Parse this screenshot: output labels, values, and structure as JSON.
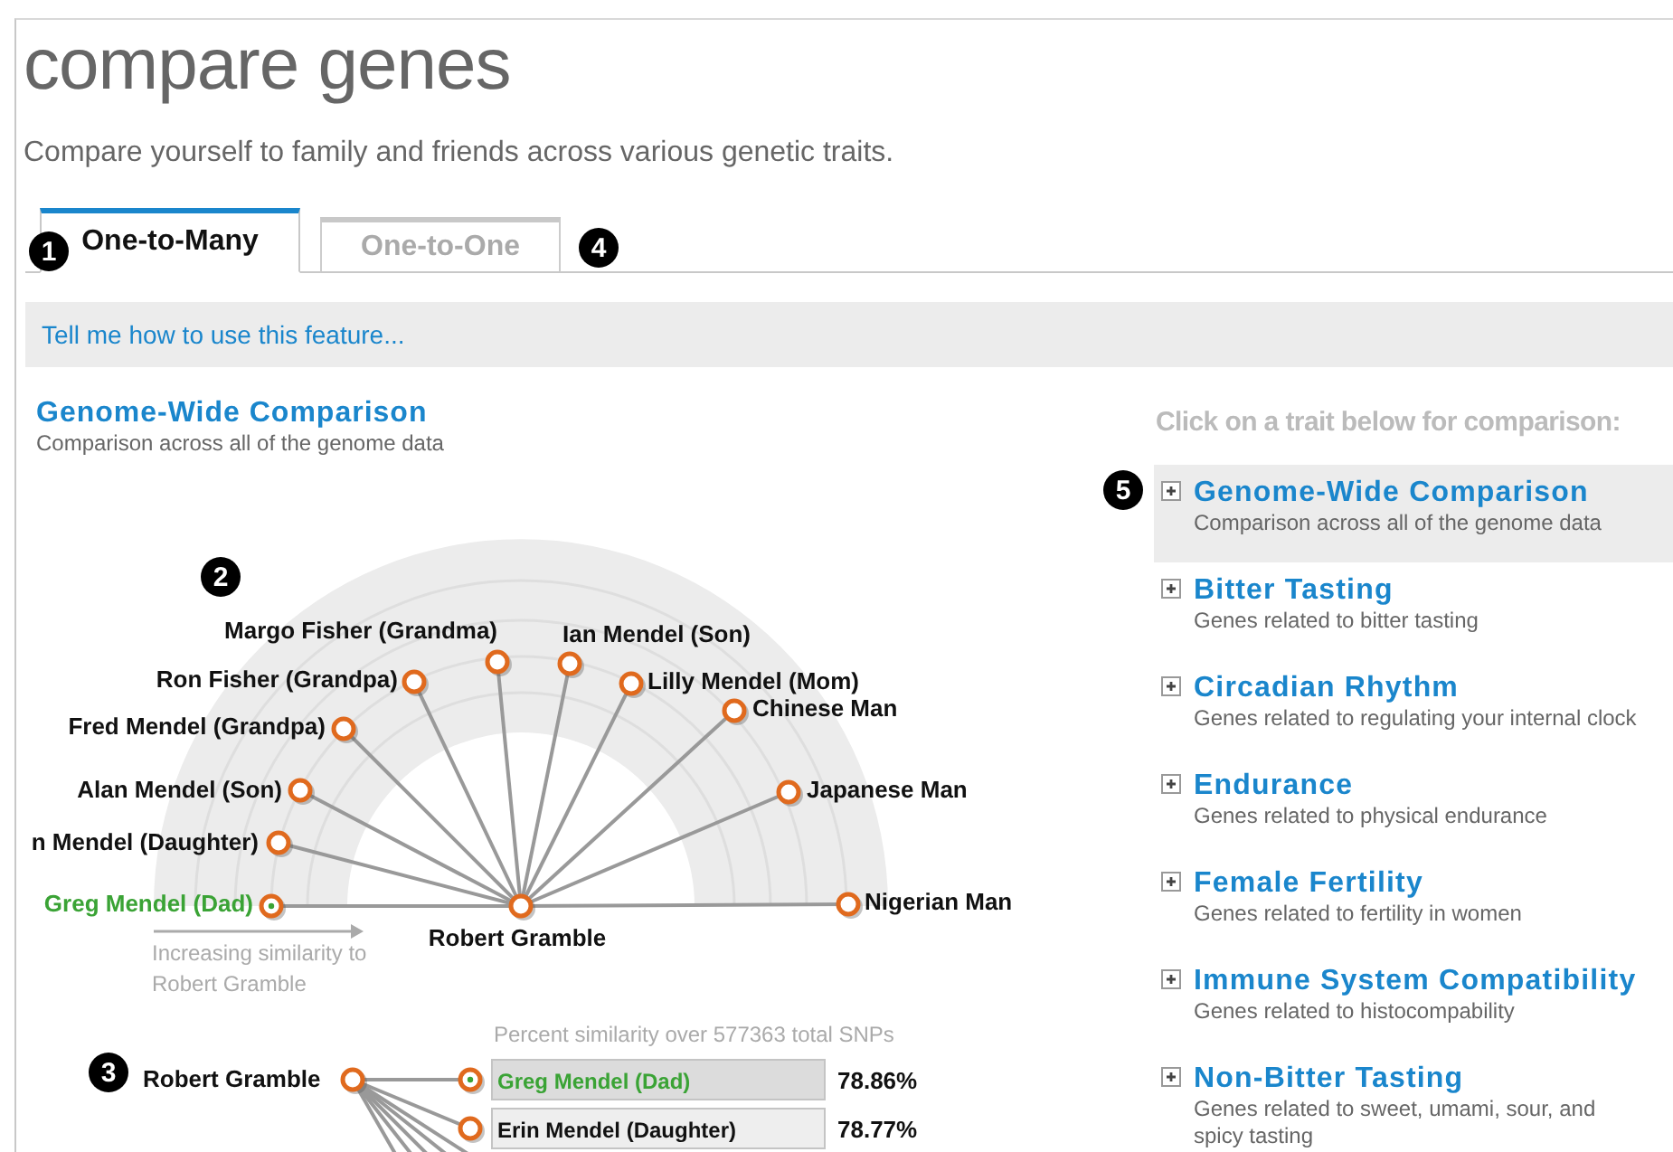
{
  "page": {
    "title": "compare genes",
    "subtitle": "Compare yourself to family and friends across various genetic traits."
  },
  "tabs": [
    {
      "label": "One-to-Many",
      "selected": true
    },
    {
      "label": "One-to-One",
      "selected": false
    }
  ],
  "help_link": "Tell me how to use this feature...",
  "section": {
    "title": "Genome-Wide Comparison",
    "description": "Comparison across all of the genome data"
  },
  "radial_chart": {
    "center": "Robert Gramble",
    "axis_note": "Increasing similarity to Robert Gramble",
    "nodes": [
      {
        "name": "Margo Fisher (Grandma)",
        "highlighted": false
      },
      {
        "name": "Ian Mendel (Son)",
        "highlighted": false
      },
      {
        "name": "Ron Fisher (Grandpa)",
        "highlighted": false
      },
      {
        "name": "Lilly Mendel (Mom)",
        "highlighted": false
      },
      {
        "name": "Fred Mendel (Grandpa)",
        "highlighted": false
      },
      {
        "name": "Chinese Man",
        "highlighted": false
      },
      {
        "name": "Alan Mendel (Son)",
        "highlighted": false
      },
      {
        "name": "Japanese Man",
        "highlighted": false
      },
      {
        "name": "n Mendel (Daughter)",
        "highlighted": false
      },
      {
        "name": "Greg Mendel (Dad)",
        "highlighted": true
      },
      {
        "name": "Nigerian Man",
        "highlighted": false
      }
    ]
  },
  "similarity_list": {
    "caption": "Percent similarity over 577363 total SNPs",
    "source": "Robert Gramble",
    "rows": [
      {
        "name": "Greg Mendel (Dad)",
        "percent": "78.86%",
        "highlighted": true
      },
      {
        "name": "Erin Mendel (Daughter)",
        "percent": "78.77%",
        "highlighted": false
      }
    ]
  },
  "traits_prompt": "Click on a trait below for comparison:",
  "traits": [
    {
      "title": "Genome-Wide Comparison",
      "description": "Comparison across all of the genome data",
      "selected": true
    },
    {
      "title": "Bitter Tasting",
      "description": "Genes related to bitter tasting",
      "selected": false
    },
    {
      "title": "Circadian Rhythm",
      "description": "Genes related to regulating your internal clock",
      "selected": false
    },
    {
      "title": "Endurance",
      "description": "Genes related to physical endurance",
      "selected": false
    },
    {
      "title": "Female Fertility",
      "description": "Genes related to fertility in women",
      "selected": false
    },
    {
      "title": "Immune System Compatibility",
      "description": "Genes related to histocompability",
      "selected": false
    },
    {
      "title": "Non-Bitter Tasting",
      "description": "Genes related to sweet, umami, sour, and\nspicy tasting",
      "selected": false
    }
  ],
  "callouts": [
    "1",
    "2",
    "3",
    "4",
    "5"
  ]
}
